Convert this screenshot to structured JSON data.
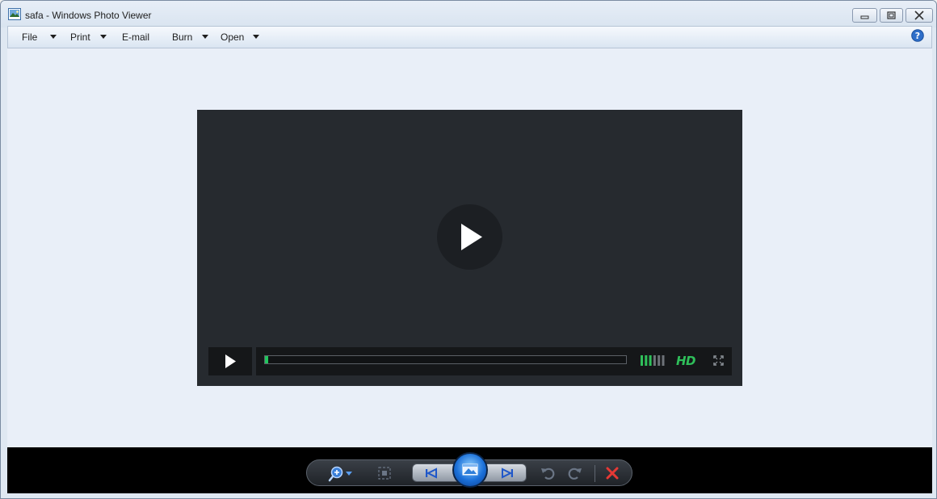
{
  "window": {
    "title": "safa - Windows Photo Viewer",
    "icon": "photo-viewer-icon"
  },
  "title_controls": {
    "minimize": "minimize-icon",
    "maximize": "maximize-icon",
    "close": "close-icon"
  },
  "menu": {
    "items": [
      {
        "label": "File",
        "has_dropdown": true
      },
      {
        "label": "Print",
        "has_dropdown": true
      },
      {
        "label": "E-mail",
        "has_dropdown": false
      },
      {
        "label": "Burn",
        "has_dropdown": true
      },
      {
        "label": "Open",
        "has_dropdown": true
      }
    ],
    "help_icon": "help-icon"
  },
  "video_player": {
    "progress": 0.01,
    "volume_bars_lit": 3,
    "volume_bars_total": 6,
    "hd_label": "HD",
    "accent_color": "#2fbf5a",
    "big_play_icon": "play-icon",
    "play_icon": "play-icon",
    "fullscreen_icon": "fullscreen-icon"
  },
  "toolbar": {
    "buttons": [
      "zoom-icon",
      "actual-size-icon",
      "previous-icon",
      "slideshow-icon",
      "next-icon",
      "rotate-counterclockwise-icon",
      "rotate-clockwise-icon",
      "delete-icon"
    ]
  }
}
